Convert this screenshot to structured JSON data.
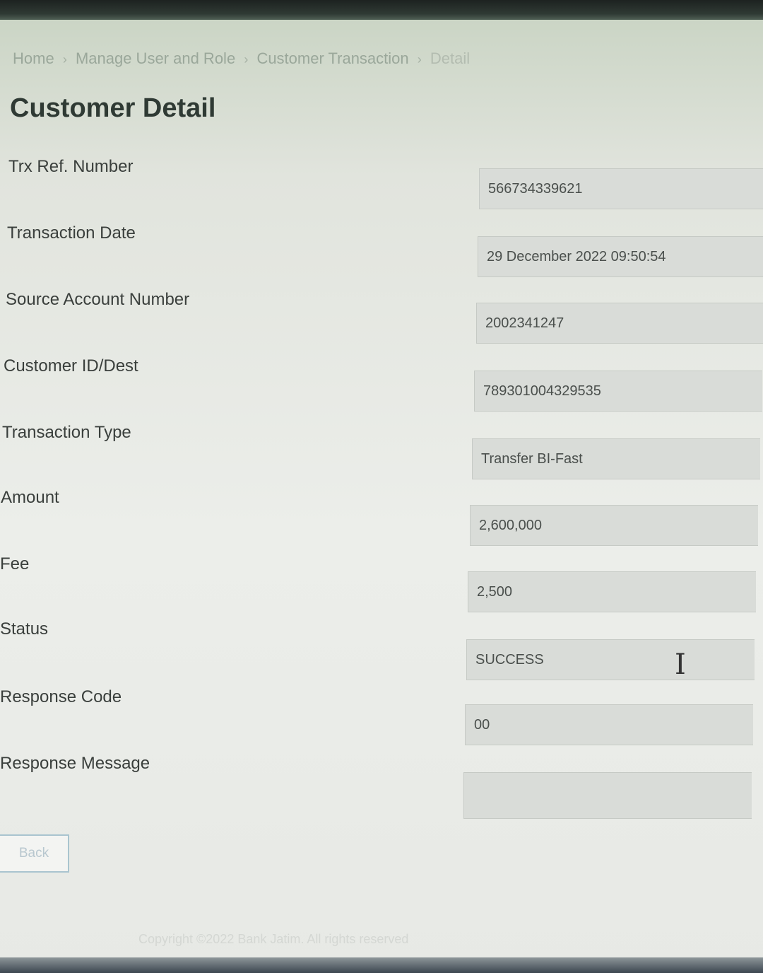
{
  "breadcrumb": [
    {
      "label": "Home"
    },
    {
      "label": "Manage User and Role"
    },
    {
      "label": "Customer Transaction"
    },
    {
      "label": "Detail"
    }
  ],
  "breadcrumb_separator": "›",
  "page_title": "Customer Detail",
  "fields": {
    "trx_ref": {
      "label": "Trx Ref. Number",
      "value": "566734339621"
    },
    "transaction_date": {
      "label": "Transaction Date",
      "value": "29 December 2022 09:50:54"
    },
    "source_account": {
      "label": "Source Account Number",
      "value": "2002341247"
    },
    "customer_id": {
      "label": "Customer ID/Dest",
      "value": "789301004329535"
    },
    "transaction_type": {
      "label": "Transaction Type",
      "value": "Transfer BI-Fast"
    },
    "amount": {
      "label": "Amount",
      "value": "2,600,000"
    },
    "fee": {
      "label": "Fee",
      "value": "2,500"
    },
    "status": {
      "label": "Status",
      "value": "SUCCESS"
    },
    "response_code": {
      "label": "Response Code",
      "value": "00"
    },
    "response_message": {
      "label": "Response Message",
      "value": ""
    }
  },
  "back_button_label": "Back",
  "footer_text": "Copyright ©2022 Bank Jatim. All rights reserved",
  "mouse_cursor": "I"
}
